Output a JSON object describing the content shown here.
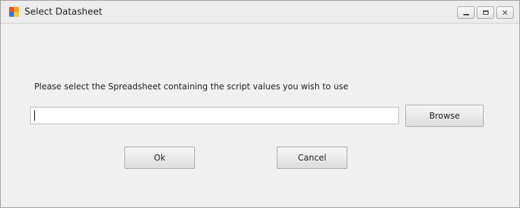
{
  "window": {
    "title": "Select Datasheet",
    "controls": {
      "minimize": "minimize-icon",
      "maximize": "maximize-icon",
      "close": "close-icon"
    }
  },
  "dialog": {
    "prompt": "Please select the Spreadsheet containing the script values you wish to use",
    "file_input": {
      "value": "",
      "placeholder": ""
    },
    "browse_label": "Browse",
    "ok_label": "Ok",
    "cancel_label": "Cancel"
  },
  "colors": {
    "app_icon": [
      "#e8542a",
      "#f6a21e",
      "#2f7fd6",
      "#f6c644"
    ],
    "window_background": "#f0f0f0"
  }
}
